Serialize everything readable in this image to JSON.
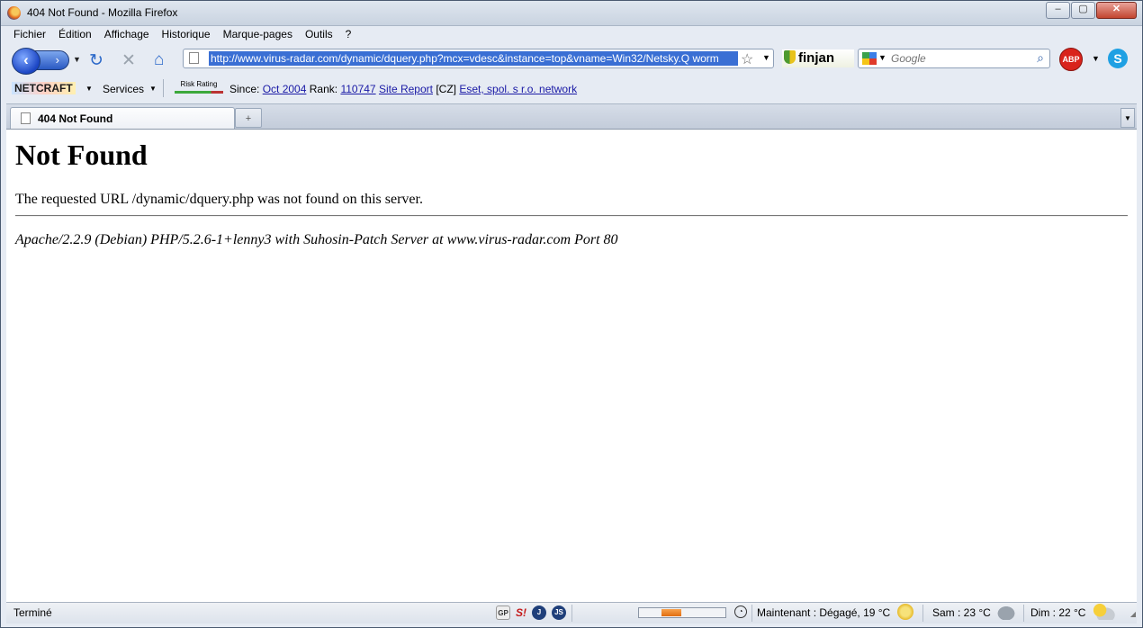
{
  "window": {
    "title": "404 Not Found - Mozilla Firefox",
    "min": "–",
    "max": "▢",
    "close": "✕"
  },
  "menu": [
    "Fichier",
    "Édition",
    "Affichage",
    "Historique",
    "Marque-pages",
    "Outils",
    "?"
  ],
  "nav": {
    "url": "http://www.virus-radar.com/dynamic/dquery.php?mcx=vdesc&instance=top&vname=Win32/Netsky.Q worm",
    "search_placeholder": "Google",
    "finjan": "finjan",
    "abp": "ABP"
  },
  "netcraft": {
    "logo": "NETCRAFT",
    "services": "Services",
    "risk_label": "Risk Rating",
    "since_label": "Since:",
    "since_value": "Oct 2004",
    "rank_label": "Rank:",
    "rank_value": "110747",
    "site_report": "Site Report",
    "country": "[CZ]",
    "network": "Eset, spol. s r.o. network"
  },
  "tabs": [
    {
      "label": "404 Not Found"
    }
  ],
  "page": {
    "heading": "Not Found",
    "message": "The requested URL /dynamic/dquery.php was not found on this server.",
    "address": "Apache/2.2.9 (Debian) PHP/5.2.6-1+lenny3 with Suhosin-Patch Server at www.virus-radar.com Port 80"
  },
  "status": {
    "text": "Terminé",
    "icons": [
      "GP",
      "S!",
      "J",
      "JS"
    ],
    "progress": 0.3,
    "weather_now": "Maintenant : Dégagé, 19 °C",
    "weather_sat": "Sam : 23 °C",
    "weather_sun": "Dim : 22 °C"
  }
}
